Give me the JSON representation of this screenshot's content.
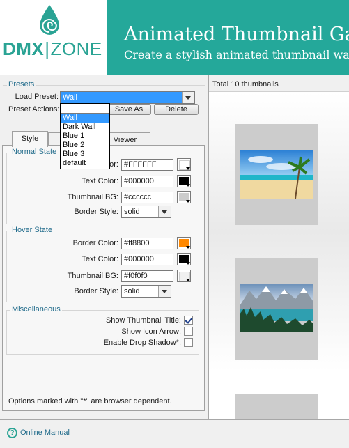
{
  "header": {
    "logo": "DMX|ZONE",
    "logo_left": "DMX",
    "logo_sep": "|",
    "logo_right": "ZONE",
    "title": "Animated Thumbnail Gal",
    "subtitle": "Create a stylish animated thumbnail wall with s"
  },
  "presets": {
    "group_title": "Presets",
    "load_label": "Load Preset:",
    "load_value": "Wall",
    "actions_label": "Preset Actions:",
    "save_as": "Save As",
    "delete": "Delete",
    "dropdown_options": [
      "Wall",
      "Dark Wall",
      "Blue 1",
      "Blue 2",
      "Blue 3",
      "default"
    ],
    "dropdown_selected": "Wall"
  },
  "tabs": [
    "Style",
    "",
    "Viewer"
  ],
  "normal_state": {
    "title": "Normal State",
    "border_color_label": "or:",
    "border_color": "#FFFFFF",
    "text_color_label": "Text Color:",
    "text_color": "#000000",
    "thumb_bg_label": "Thumbnail BG:",
    "thumb_bg": "#cccccc",
    "border_style_label": "Border Style:",
    "border_style": "solid"
  },
  "hover_state": {
    "title": "Hover State",
    "border_color_label": "Border Color:",
    "border_color": "#ff8800",
    "text_color_label": "Text Color:",
    "text_color": "#000000",
    "thumb_bg_label": "Thumbnail BG:",
    "thumb_bg": "#f0f0f0",
    "border_style_label": "Border Style:",
    "border_style": "solid"
  },
  "misc": {
    "title": "Miscellaneous",
    "show_title_label": "Show Thumbnail Title:",
    "show_title": true,
    "show_arrow_label": "Show Icon Arrow:",
    "show_arrow": false,
    "drop_shadow_label": "Enable Drop Shadow*:",
    "drop_shadow": false
  },
  "note": "Options marked with \"*\" are browser dependent.",
  "preview": {
    "header": "Total 10 thumbnails",
    "thumbnails": [
      "beach-photo",
      "mountain-lake-photo",
      "next-thumbnail"
    ]
  },
  "footer": {
    "manual": "Online Manual"
  },
  "colors": {
    "brand": "#24a89a",
    "accent_orange": "#ff8800",
    "thumb_bg": "#cccccc",
    "selection": "#3399ff"
  }
}
